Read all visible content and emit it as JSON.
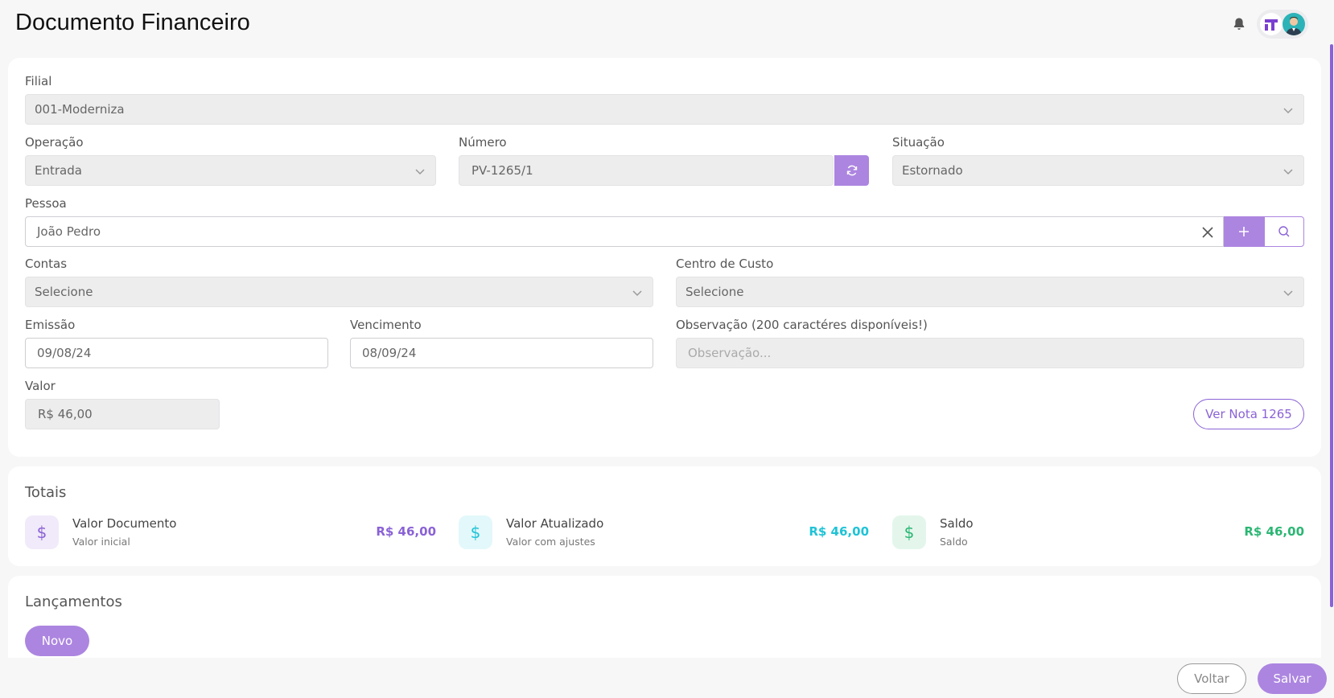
{
  "header": {
    "title": "Documento Financeiro"
  },
  "form": {
    "filial": {
      "label": "Filial",
      "value": "001-Moderniza"
    },
    "operacao": {
      "label": "Operação",
      "value": "Entrada"
    },
    "numero": {
      "label": "Número",
      "value": "PV-1265/1"
    },
    "situacao": {
      "label": "Situação",
      "value": "Estornado"
    },
    "pessoa": {
      "label": "Pessoa",
      "value": "João Pedro"
    },
    "contas": {
      "label": "Contas",
      "value": "Selecione"
    },
    "centro_custo": {
      "label": "Centro de Custo",
      "value": "Selecione"
    },
    "emissao": {
      "label": "Emissão",
      "value": "09/08/24"
    },
    "vencimento": {
      "label": "Vencimento",
      "value": "08/09/24"
    },
    "observacao": {
      "label": "Observação (200 caractéres disponíveis!)",
      "placeholder": "Observação..."
    },
    "valor": {
      "label": "Valor",
      "value": "R$ 46,00"
    },
    "ver_nota_label": "Ver Nota 1265"
  },
  "totais": {
    "title": "Totais",
    "items": [
      {
        "title": "Valor Documento",
        "subtitle": "Valor inicial",
        "value": "R$ 46,00",
        "icon": "dollar-icon"
      },
      {
        "title": "Valor Atualizado",
        "subtitle": "Valor com ajustes",
        "value": "R$ 46,00",
        "icon": "dollar-icon"
      },
      {
        "title": "Saldo",
        "subtitle": "Saldo",
        "value": "R$ 46,00",
        "icon": "dollar-icon"
      }
    ]
  },
  "lancamentos": {
    "title": "Lançamentos",
    "novo_label": "Novo"
  },
  "footer": {
    "voltar_label": "Voltar",
    "salvar_label": "Salvar"
  },
  "colors": {
    "accent": "#8a62d6",
    "accent_light": "#ac85e0",
    "cyan": "#1fc3d6",
    "green": "#2bb673"
  }
}
